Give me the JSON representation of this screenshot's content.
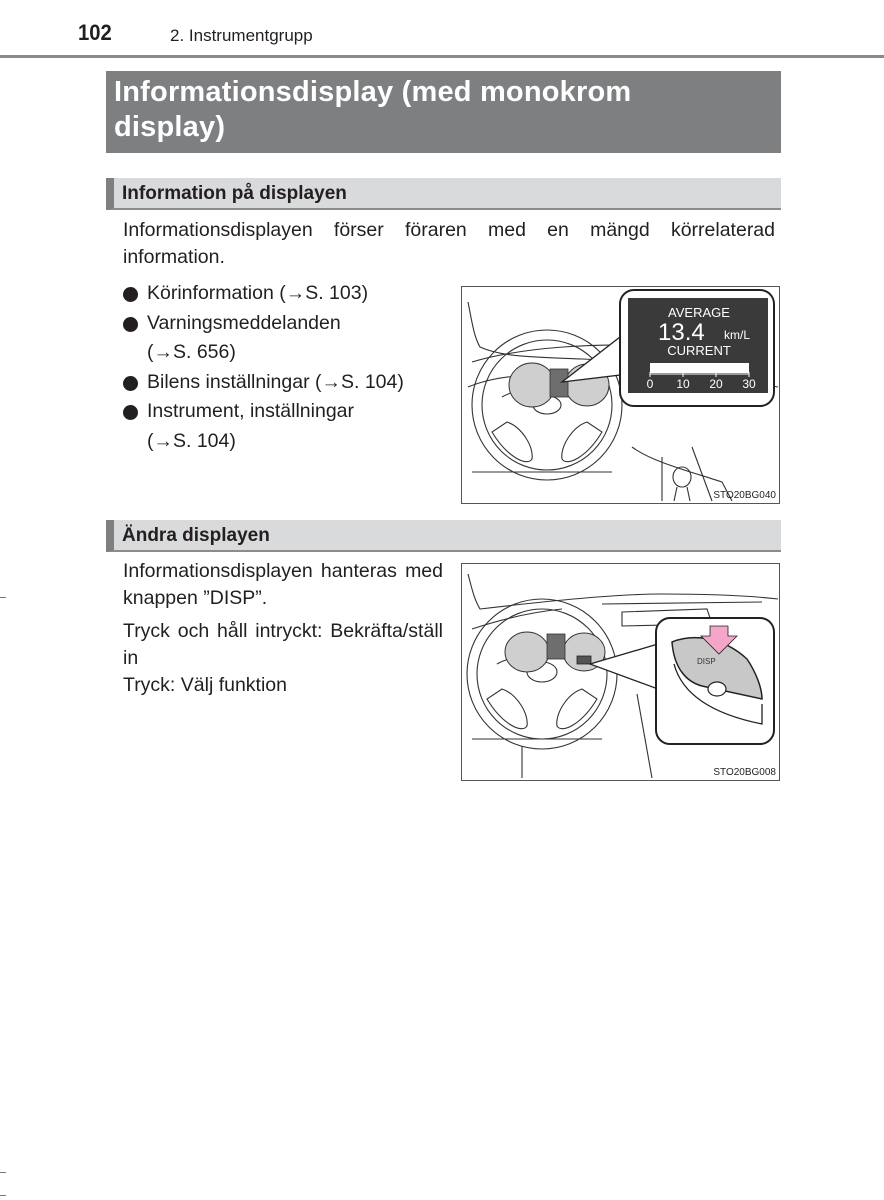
{
  "header": {
    "page_number": "102",
    "chapter": "2. Instrumentgrupp"
  },
  "main_title": {
    "line1": "Informationsdisplay (med monokrom",
    "line2": "display)"
  },
  "section1": {
    "heading": "Information på displayen",
    "intro": "Informationsdisplayen förser föraren med en mängd körrelaterad information.",
    "bullets": [
      {
        "text": "Körinformation (→S. 103)"
      },
      {
        "text": "Varningsmeddelanden (→S. 656)"
      },
      {
        "text": "Bilens inställningar (→S. 104)"
      },
      {
        "text": "Instrument, inställningar (→S. 104)"
      }
    ],
    "figure": {
      "code": "STO20BG040",
      "display": {
        "label_top": "AVERAGE",
        "value": "13.4",
        "unit": "km/L",
        "label_bottom": "CURRENT",
        "scale_ticks": [
          "0",
          "10",
          "20",
          "30"
        ],
        "bar_fill_fraction": 1.0
      },
      "colors": {
        "display_bg": "#3a3a3a",
        "cluster_highlight": "#6e6e6e",
        "gauge_fill": "#cfcfcf"
      }
    }
  },
  "section2": {
    "heading": "Ändra displayen",
    "para1": "Informationsdisplayen hanteras med knappen ”DISP”.",
    "para2": "Tryck och håll intryckt: Bekräfta/ställ in",
    "para3": "Tryck: Välj funktion",
    "figure": {
      "code": "STO20BG008",
      "button_label": "DISP",
      "colors": {
        "arrow": "#f4a6c8",
        "button": "#c8c8c8"
      }
    }
  }
}
